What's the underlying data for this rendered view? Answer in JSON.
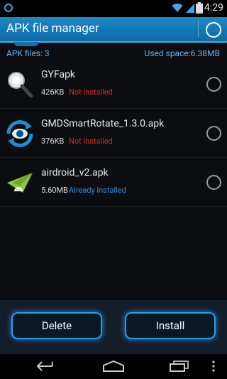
{
  "status_bar": {
    "time": "4:29"
  },
  "title_bar": {
    "title": "APK file manager"
  },
  "info": {
    "apk_files": "APK files: 3",
    "used_space": "Used space:6.38MB"
  },
  "files": [
    {
      "name": "GYFapk",
      "size": "426KB",
      "status": "Not installed",
      "status_color": "#d02a2a",
      "icon": "magnifier-icon"
    },
    {
      "name": "GMDSmartRotate_1.3.0.apk",
      "size": "376KB",
      "status": "Not installed",
      "status_color": "#d02a2a",
      "icon": "rotate-eye-icon"
    },
    {
      "name": "airdroid_v2.apk",
      "size": "5.60MB",
      "status": "Already installed",
      "status_color": "#3b8fe0",
      "icon": "paper-plane-android-icon"
    }
  ],
  "buttons": {
    "delete": "Delete",
    "install": "Install"
  },
  "colors": {
    "accent": "#2a9de8",
    "title_bar": "#1e88c8",
    "not_installed": "#d02a2a",
    "installed": "#3b8fe0"
  }
}
